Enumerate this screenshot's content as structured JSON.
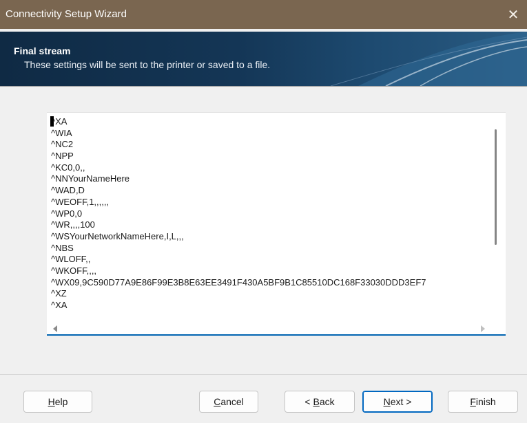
{
  "window": {
    "title": "Connectivity Setup Wizard",
    "close_glyph": "✕"
  },
  "banner": {
    "title": "Final stream",
    "subtitle": "These settings will be sent to the printer or saved to a file."
  },
  "stream": {
    "lines": [
      "^XA",
      "^WIA",
      "^NC2",
      "^NPP",
      "^KC0,0,,",
      "^NNYourNameHere",
      "^WAD,D",
      "^WEOFF,1,,,,,,",
      "^WP0,0",
      "^WR,,,,100",
      "^WSYourNetworkNameHere,I,L,,,",
      "^NBS",
      "^WLOFF,,",
      "^WKOFF,,,,",
      "^WX09,9C590D77A9E86F99E3B8E63EE3491F430A5BF9B1C85510DC168F33030DDD3EF7",
      "^XZ",
      "^XA"
    ]
  },
  "buttons": {
    "help": {
      "mnemonic": "H",
      "rest": "elp"
    },
    "cancel": {
      "mnemonic": "C",
      "rest": "ancel"
    },
    "back": {
      "prefix": "< ",
      "mnemonic": "B",
      "rest": "ack"
    },
    "next": {
      "mnemonic": "N",
      "rest": "ext >"
    },
    "finish": {
      "mnemonic": "F",
      "rest": "inish"
    }
  },
  "icons": {
    "close": "close-icon",
    "scroll_left": "scroll-left-arrow-icon",
    "scroll_right": "scroll-right-arrow-icon"
  },
  "colors": {
    "titlebar": "#7a6650",
    "banner": "#143656",
    "accent": "#0067c0"
  }
}
